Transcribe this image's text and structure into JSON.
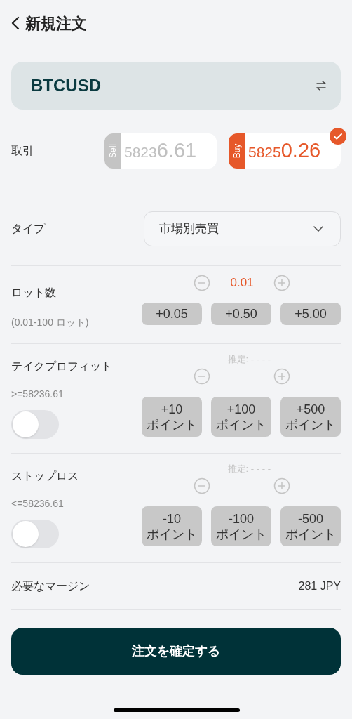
{
  "header": {
    "title": "新規注文"
  },
  "symbol": {
    "name": "BTCUSD"
  },
  "trade": {
    "label": "取引",
    "sides": [
      {
        "kind": "sell",
        "tag": "Sell",
        "price_head": "5823",
        "price_tail": "6.61",
        "selected": false
      },
      {
        "kind": "buy",
        "tag": "Buy",
        "price_head": "5825",
        "price_tail": "0.26",
        "selected": true
      }
    ]
  },
  "type": {
    "label": "タイプ",
    "value": "市場別売買"
  },
  "lots": {
    "label": "ロット数",
    "range": "(0.01-100 ロット)",
    "value": "0.01",
    "presets": [
      "+0.05",
      "+0.50",
      "+5.00"
    ]
  },
  "take_profit": {
    "label": "テイクプロフィット",
    "estimate": "推定: - - - -",
    "limit": ">=58236.61",
    "on": false,
    "presets": [
      {
        "amount": "+10",
        "unit": "ポイント"
      },
      {
        "amount": "+100",
        "unit": "ポイント"
      },
      {
        "amount": "+500",
        "unit": "ポイント"
      }
    ]
  },
  "stop_loss": {
    "label": "ストップロス",
    "estimate": "推定: - - - -",
    "limit": "<=58236.61",
    "on": false,
    "presets": [
      {
        "amount": "-10",
        "unit": "ポイント"
      },
      {
        "amount": "-100",
        "unit": "ポイント"
      },
      {
        "amount": "-500",
        "unit": "ポイント"
      }
    ]
  },
  "margin": {
    "label": "必要なマージン",
    "value": "281 JPY"
  },
  "confirm_button": "注文を確定する"
}
